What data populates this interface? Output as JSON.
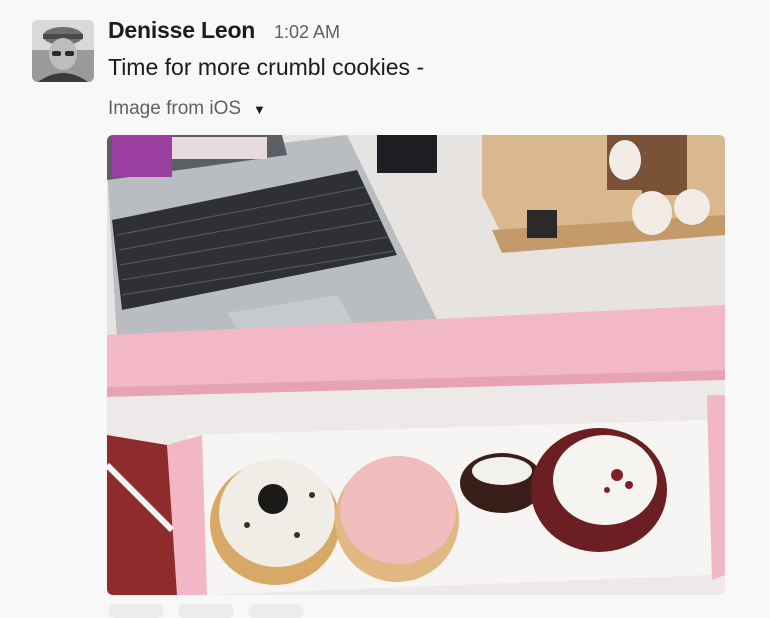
{
  "message": {
    "author": "Denisse Leon",
    "timestamp": "1:02 AM",
    "text": "Time for more crumbl cookies -",
    "attachment_label": "Image from iOS",
    "attachment_caret_icon": "caret-down-icon",
    "avatar_icon": "user-avatar",
    "photo_subject": "crumbl-cookies-box"
  }
}
